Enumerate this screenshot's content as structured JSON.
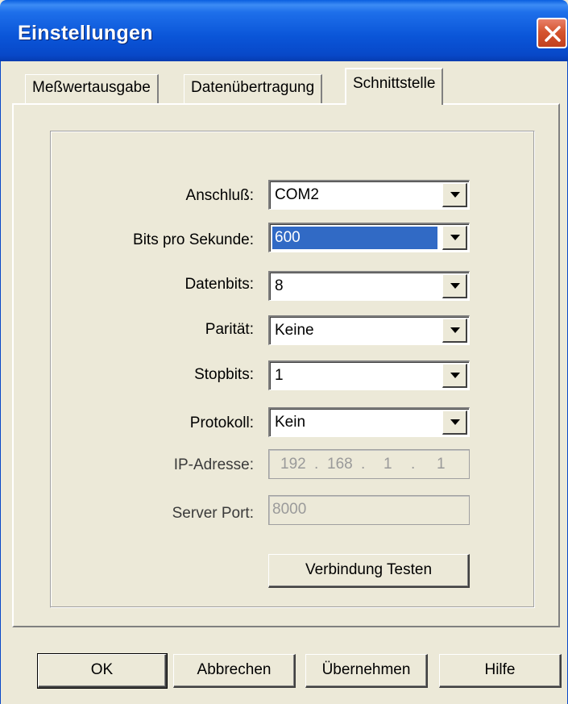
{
  "window": {
    "title": "Einstellungen"
  },
  "tabs": [
    {
      "label": "Meßwertausgabe",
      "active": false
    },
    {
      "label": "Datenübertragung",
      "active": false
    },
    {
      "label": "Schnittstelle",
      "active": true
    }
  ],
  "form": {
    "anschluss": {
      "label": "Anschluß:",
      "value": "COM2"
    },
    "bits_pro_sekunde": {
      "label": "Bits pro Sekunde:",
      "value": "600"
    },
    "datenbits": {
      "label": "Datenbits:",
      "value": "8"
    },
    "paritaet": {
      "label": "Parität:",
      "value": "Keine"
    },
    "stopbits": {
      "label": "Stopbits:",
      "value": "1"
    },
    "protokoll": {
      "label": "Protokoll:",
      "value": "Kein"
    },
    "ip_adresse": {
      "label": "IP-Adresse:",
      "octets": [
        "192",
        "168",
        "1",
        "1"
      ]
    },
    "server_port": {
      "label": "Server Port:",
      "value": "8000"
    },
    "test_button": "Verbindung Testen"
  },
  "buttons": {
    "ok": "OK",
    "cancel": "Abbrechen",
    "apply": "Übernehmen",
    "help": "Hilfe"
  },
  "colors": {
    "titlebar": "#0A55D8",
    "selection": "#316AC5",
    "close": "#D5552F",
    "dialog_bg": "#ECE9D8"
  }
}
